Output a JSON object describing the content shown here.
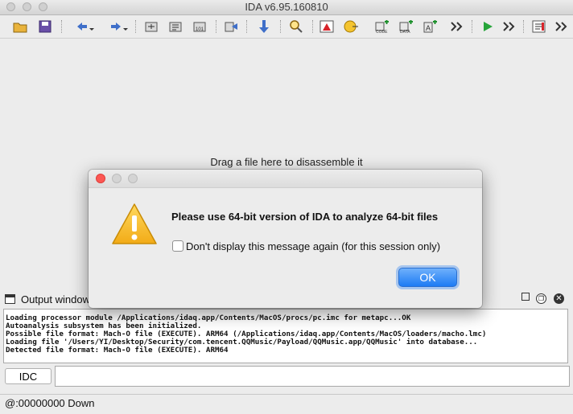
{
  "window": {
    "title": "IDA v6.95.160810"
  },
  "toolbar": {
    "icons": [
      "open-folder-icon",
      "save-icon",
      "back-arrow-icon",
      "forward-arrow-icon",
      "jump-icon",
      "jump-name-icon",
      "jump-address-icon",
      "jump-segment-icon",
      "down-arrow-icon",
      "search-icon",
      "text-icon",
      "color-icon",
      "code-icon",
      "data-icon",
      "string-icon",
      "more-icon",
      "run-icon",
      "more-icon",
      "chooser-icon",
      "more-icon"
    ]
  },
  "main": {
    "drag_hint": "Drag a file here to disassemble it"
  },
  "output": {
    "title": "Output window",
    "lines": [
      "Loading processor module /Applications/idaq.app/Contents/MacOS/procs/pc.imc for metapc...OK",
      "Autoanalysis subsystem has been initialized.",
      "Possible file format: Mach-O file (EXECUTE). ARM64 (/Applications/idaq.app/Contents/MacOS/loaders/macho.lmc)",
      "Loading file '/Users/YI/Desktop/Security/com.tencent.QQMusic/Payload/QQMusic.app/QQMusic' into database...",
      "Detected file format: Mach-O file (EXECUTE). ARM64"
    ]
  },
  "idc": {
    "button_label": "IDC",
    "input_value": ""
  },
  "status": {
    "text": "@:00000000  Down"
  },
  "dialog": {
    "message": "Please use 64-bit version of IDA to analyze 64-bit files",
    "checkbox_label": "Don't display this message again (for this session only)",
    "checkbox_checked": false,
    "ok_label": "OK"
  }
}
